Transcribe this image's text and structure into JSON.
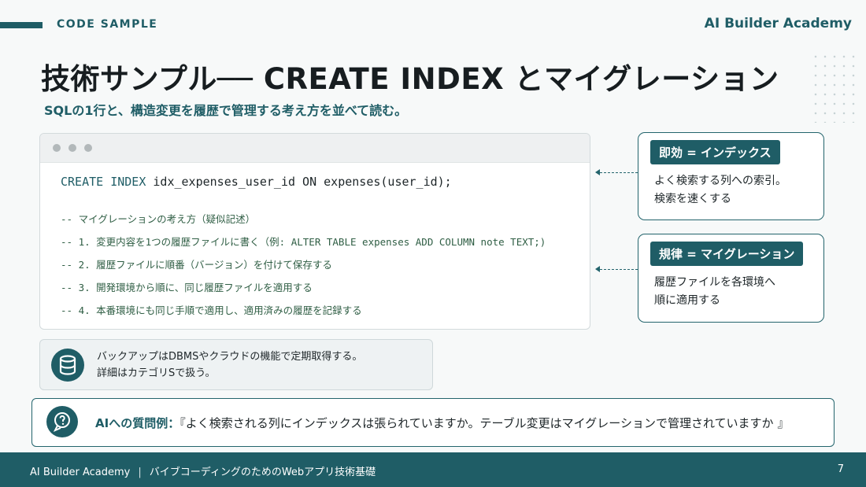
{
  "header": {
    "section_label": "CODE SAMPLE",
    "brand": "AI Builder Academy"
  },
  "title": "技術サンプル── CREATE INDEX とマイグレーション",
  "subtitle": "SQLの1行と、構造変更を履歴で管理する考え方を並べて読む。",
  "code": {
    "main_keyword": "CREATE INDEX",
    "main_rest": " idx_expenses_user_id ON expenses(user_id);",
    "comments": [
      "-- マイグレーションの考え方（疑似記述）",
      "-- 1. 変更内容を1つの履歴ファイルに書く（例: ALTER TABLE expenses ADD COLUMN note TEXT;)",
      "-- 2. 履歴ファイルに順番（バージョン）を付けて保存する",
      "-- 3. 開発環境から順に、同じ履歴ファイルを適用する",
      "-- 4. 本番環境にも同じ手順で適用し、適用済みの履歴を記録する"
    ]
  },
  "callouts": [
    {
      "tag": "即効 = インデックス",
      "lines": [
        "よく検索する列への索引。",
        "検索を速くする"
      ]
    },
    {
      "tag": "規律 = マイグレーション",
      "lines": [
        "履歴ファイルを各環境へ",
        "順に適用する"
      ]
    }
  ],
  "note": {
    "icon": "database-icon",
    "lines": [
      "バックアップはDBMSやクラウドの機能で定期取得する。",
      "詳細はカテゴリSで扱う。"
    ]
  },
  "ask": {
    "icon": "question-bubble-icon",
    "label": "AIへの質問例：",
    "text": "『よく検索される列にインデックスは張られていますか。テーブル変更はマイグレーションで管理されていますか 』"
  },
  "footer": {
    "brand": "AI Builder Academy",
    "separator": "|",
    "course": "バイブコーディングのためのWebアプリ技術基礎",
    "page": "7"
  },
  "colors": {
    "accent": "#1f5d66",
    "background": "#f7f9f9",
    "comment": "#2f5e44"
  }
}
